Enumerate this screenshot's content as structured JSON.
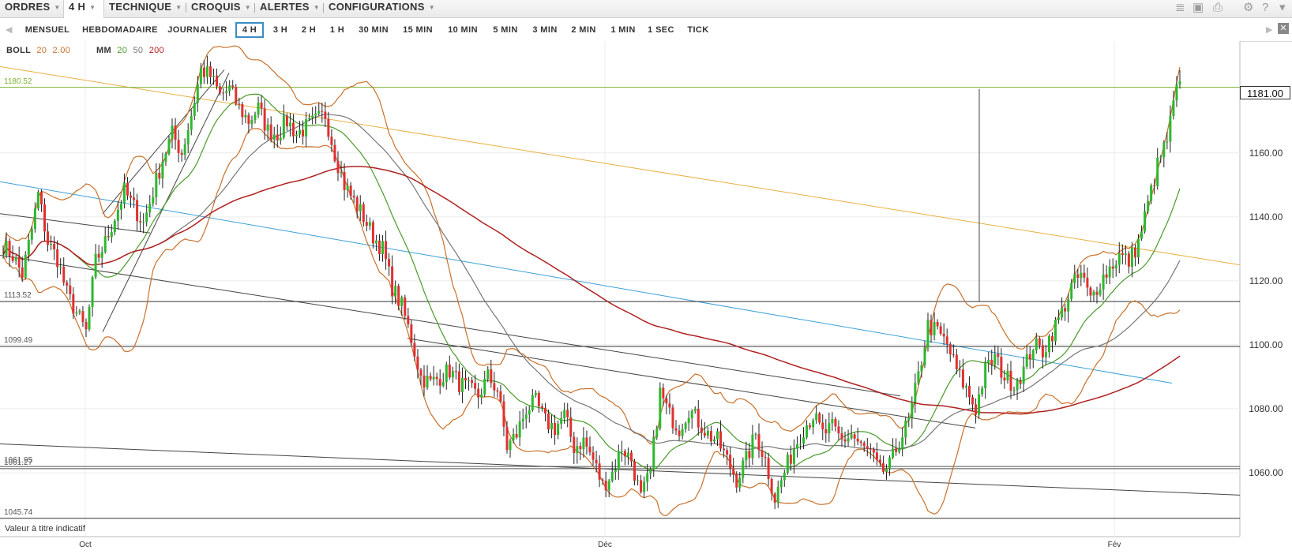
{
  "menu": [
    {
      "label": "ORDRES",
      "dropdown": true
    },
    {
      "label": "4 H",
      "dropdown": true,
      "active": true
    },
    {
      "label": "TECHNIQUE",
      "dropdown": true
    },
    {
      "label": "CROQUIS",
      "dropdown": true
    },
    {
      "label": "ALERTES",
      "dropdown": true
    },
    {
      "label": "CONFIGURATIONS",
      "dropdown": true
    }
  ],
  "toolbar_icons": [
    "layers-icon",
    "image-icon",
    "print-icon",
    "gear-icon",
    "help-icon",
    "comment-icon"
  ],
  "timeframes": [
    "MENSUEL",
    "HEBDOMADAIRE",
    "JOURNALIER",
    "4 H",
    "3 H",
    "2 H",
    "1 H",
    "30 MIN",
    "15 MIN",
    "10 MIN",
    "5 MIN",
    "3 MIN",
    "2 MIN",
    "1 MIN",
    "1 SEC",
    "TICK"
  ],
  "active_timeframe": "4 H",
  "legend": {
    "boll": {
      "name": "BOLL",
      "period": "20",
      "mult": "2.00",
      "color": "#c8702a"
    },
    "mm": {
      "name": "MM",
      "p1": "20",
      "p2": "50",
      "p3": "200",
      "c1": "#4a9a2a",
      "c2": "#777777",
      "c3": "#b02020"
    }
  },
  "current_price": "1181.00",
  "horizontal_levels": [
    {
      "label": "1180.52",
      "value": 1180.52,
      "color": "#7db030"
    },
    {
      "label": "1113.52",
      "value": 1113.52,
      "color": "#333333"
    },
    {
      "label": "1099.49",
      "value": 1099.49,
      "color": "#333333"
    },
    {
      "label": "1061.95",
      "value": 1061.95,
      "color": "#555555"
    },
    {
      "label": "1061.27",
      "value": 1061.27,
      "color": "#555555"
    },
    {
      "label": "1045.74",
      "value": 1045.74,
      "color": "#333333"
    }
  ],
  "note": "Valeur à titre indicatif",
  "colors": {
    "up": "#2db82d",
    "down": "#e03030",
    "yellow": "#e8b040",
    "blue": "#3aa0d8",
    "trend": "#444444"
  },
  "chart_data": {
    "type": "line",
    "ylim": [
      1040,
      1195
    ],
    "y_ticks": [
      "1160.00",
      "1140.00",
      "1120.00",
      "1100.00",
      "1080.00",
      "1060.00"
    ],
    "x_labels": [
      "Oct",
      "Déc",
      "Fév"
    ],
    "close_path": [
      {
        "x": 0,
        "y": 1131
      },
      {
        "x": 3,
        "y": 1128
      },
      {
        "x": 6,
        "y": 1122
      },
      {
        "x": 9,
        "y": 1136
      },
      {
        "x": 11,
        "y": 1147
      },
      {
        "x": 14,
        "y": 1132
      },
      {
        "x": 17,
        "y": 1127
      },
      {
        "x": 20,
        "y": 1116
      },
      {
        "x": 23,
        "y": 1110
      },
      {
        "x": 26,
        "y": 1104
      },
      {
        "x": 29,
        "y": 1126
      },
      {
        "x": 32,
        "y": 1132
      },
      {
        "x": 35,
        "y": 1140
      },
      {
        "x": 38,
        "y": 1148
      },
      {
        "x": 41,
        "y": 1143
      },
      {
        "x": 44,
        "y": 1138
      },
      {
        "x": 47,
        "y": 1148
      },
      {
        "x": 50,
        "y": 1158
      },
      {
        "x": 53,
        "y": 1166
      },
      {
        "x": 56,
        "y": 1160
      },
      {
        "x": 59,
        "y": 1172
      },
      {
        "x": 62,
        "y": 1186
      },
      {
        "x": 65,
        "y": 1184
      },
      {
        "x": 68,
        "y": 1178
      },
      {
        "x": 71,
        "y": 1180
      },
      {
        "x": 74,
        "y": 1174
      },
      {
        "x": 77,
        "y": 1170
      },
      {
        "x": 80,
        "y": 1174
      },
      {
        "x": 83,
        "y": 1167
      },
      {
        "x": 86,
        "y": 1166
      },
      {
        "x": 89,
        "y": 1170
      },
      {
        "x": 92,
        "y": 1166
      },
      {
        "x": 95,
        "y": 1168
      },
      {
        "x": 98,
        "y": 1170
      },
      {
        "x": 101,
        "y": 1172
      },
      {
        "x": 104,
        "y": 1160
      },
      {
        "x": 107,
        "y": 1150
      },
      {
        "x": 110,
        "y": 1145
      },
      {
        "x": 113,
        "y": 1140
      },
      {
        "x": 116,
        "y": 1134
      },
      {
        "x": 119,
        "y": 1130
      },
      {
        "x": 122,
        "y": 1118
      },
      {
        "x": 125,
        "y": 1112
      },
      {
        "x": 128,
        "y": 1102
      },
      {
        "x": 131,
        "y": 1090
      },
      {
        "x": 134,
        "y": 1088
      },
      {
        "x": 137,
        "y": 1090
      },
      {
        "x": 140,
        "y": 1092
      },
      {
        "x": 143,
        "y": 1088
      },
      {
        "x": 146,
        "y": 1086
      },
      {
        "x": 149,
        "y": 1084
      },
      {
        "x": 152,
        "y": 1090
      },
      {
        "x": 155,
        "y": 1086
      },
      {
        "x": 158,
        "y": 1068
      },
      {
        "x": 161,
        "y": 1072
      },
      {
        "x": 164,
        "y": 1080
      },
      {
        "x": 167,
        "y": 1082
      },
      {
        "x": 170,
        "y": 1076
      },
      {
        "x": 173,
        "y": 1074
      },
      {
        "x": 176,
        "y": 1078
      },
      {
        "x": 179,
        "y": 1068
      },
      {
        "x": 182,
        "y": 1070
      },
      {
        "x": 185,
        "y": 1064
      },
      {
        "x": 188,
        "y": 1056
      },
      {
        "x": 191,
        "y": 1060
      },
      {
        "x": 194,
        "y": 1068
      },
      {
        "x": 197,
        "y": 1064
      },
      {
        "x": 200,
        "y": 1052
      },
      {
        "x": 203,
        "y": 1060
      },
      {
        "x": 206,
        "y": 1085
      },
      {
        "x": 209,
        "y": 1078
      },
      {
        "x": 212,
        "y": 1074
      },
      {
        "x": 215,
        "y": 1080
      },
      {
        "x": 218,
        "y": 1076
      },
      {
        "x": 221,
        "y": 1072
      },
      {
        "x": 224,
        "y": 1070
      },
      {
        "x": 227,
        "y": 1064
      },
      {
        "x": 230,
        "y": 1058
      },
      {
        "x": 233,
        "y": 1064
      },
      {
        "x": 236,
        "y": 1072
      },
      {
        "x": 239,
        "y": 1064
      },
      {
        "x": 242,
        "y": 1052
      },
      {
        "x": 245,
        "y": 1060
      },
      {
        "x": 248,
        "y": 1068
      },
      {
        "x": 251,
        "y": 1074
      },
      {
        "x": 254,
        "y": 1078
      },
      {
        "x": 257,
        "y": 1072
      },
      {
        "x": 260,
        "y": 1074
      },
      {
        "x": 263,
        "y": 1070
      },
      {
        "x": 266,
        "y": 1072
      },
      {
        "x": 269,
        "y": 1068
      },
      {
        "x": 272,
        "y": 1066
      },
      {
        "x": 275,
        "y": 1060
      },
      {
        "x": 278,
        "y": 1062
      },
      {
        "x": 281,
        "y": 1070
      },
      {
        "x": 284,
        "y": 1076
      },
      {
        "x": 287,
        "y": 1090
      },
      {
        "x": 290,
        "y": 1106
      },
      {
        "x": 293,
        "y": 1104
      },
      {
        "x": 296,
        "y": 1100
      },
      {
        "x": 299,
        "y": 1092
      },
      {
        "x": 302,
        "y": 1086
      },
      {
        "x": 305,
        "y": 1080
      },
      {
        "x": 308,
        "y": 1092
      },
      {
        "x": 311,
        "y": 1096
      },
      {
        "x": 314,
        "y": 1090
      },
      {
        "x": 317,
        "y": 1088
      },
      {
        "x": 320,
        "y": 1092
      },
      {
        "x": 323,
        "y": 1100
      },
      {
        "x": 326,
        "y": 1098
      },
      {
        "x": 329,
        "y": 1104
      },
      {
        "x": 332,
        "y": 1110
      },
      {
        "x": 335,
        "y": 1118
      },
      {
        "x": 338,
        "y": 1122
      },
      {
        "x": 341,
        "y": 1114
      },
      {
        "x": 344,
        "y": 1120
      },
      {
        "x": 347,
        "y": 1124
      },
      {
        "x": 350,
        "y": 1128
      },
      {
        "x": 353,
        "y": 1126
      },
      {
        "x": 356,
        "y": 1132
      },
      {
        "x": 359,
        "y": 1144
      },
      {
        "x": 362,
        "y": 1156
      },
      {
        "x": 365,
        "y": 1164
      },
      {
        "x": 368,
        "y": 1180
      }
    ],
    "bar_count": 370
  }
}
